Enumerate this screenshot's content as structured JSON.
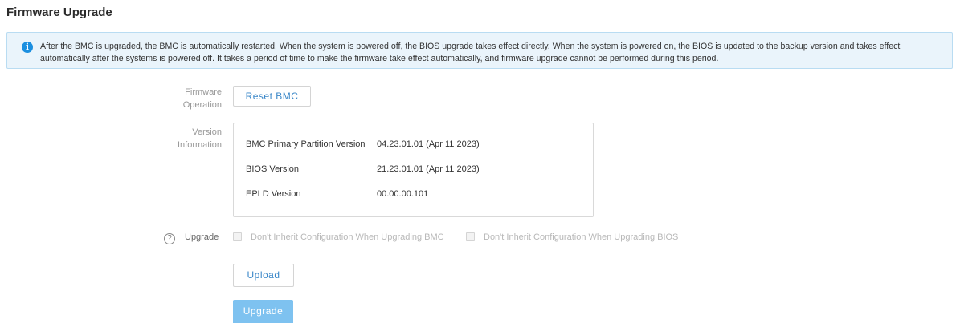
{
  "page": {
    "title": "Firmware Upgrade"
  },
  "notice": {
    "icon": "info-icon",
    "text": "After the BMC is upgraded, the BMC is automatically restarted. When the system is powered off, the BIOS upgrade takes effect directly. When the system is powered on, the BIOS is updated to the backup version and takes effect automatically after the systems is powered off. It takes a period of time to make the firmware take effect automatically, and firmware upgrade cannot be performed during this period."
  },
  "firmware_operation": {
    "label_line1": "Firmware",
    "label_line2": "Operation",
    "reset_button": "Reset BMC"
  },
  "version_information": {
    "label_line1": "Version",
    "label_line2": "Information",
    "rows": [
      {
        "name": "BMC Primary Partition Version",
        "value": "04.23.01.01  (Apr 11 2023)"
      },
      {
        "name": "BIOS Version",
        "value": "21.23.01.01  (Apr 11 2023)"
      },
      {
        "name": "EPLD Version",
        "value": "00.00.00.101"
      }
    ]
  },
  "upgrade": {
    "help_icon": "question-circle-icon",
    "help_glyph": "?",
    "label": "Upgrade",
    "checkbox_bmc": "Don't Inherit Configuration When Upgrading BMC",
    "checkbox_bios": "Don't Inherit Configuration When Upgrading BIOS",
    "checkbox_bmc_checked": false,
    "checkbox_bios_checked": false,
    "upload_button": "Upload",
    "upgrade_button": "Upgrade"
  },
  "colors": {
    "accent": "#1b8fe0",
    "button_text": "#3a87c8",
    "upgrade_button_disabled": "#7ec2f0",
    "notice_background": "#eaf4fb",
    "notice_border": "#b9dcf2"
  }
}
